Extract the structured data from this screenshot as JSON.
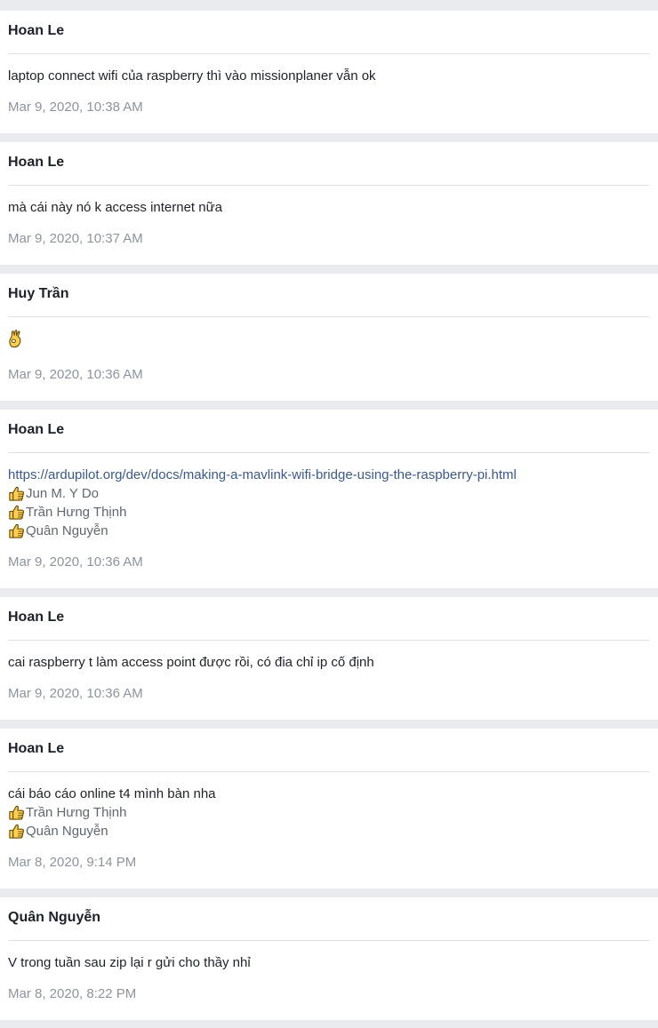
{
  "posts": [
    {
      "author": "Hoan Le",
      "lines": [
        {
          "type": "text",
          "text": "laptop connect wifi của raspberry thì vào missionplaner vẫn ok"
        }
      ],
      "reactions": [],
      "timestamp": "Mar 9, 2020, 10:38 AM"
    },
    {
      "author": "Hoan Le",
      "lines": [
        {
          "type": "text",
          "text": "mà cái này nó k access internet nữa"
        }
      ],
      "reactions": [],
      "timestamp": "Mar 9, 2020, 10:37 AM"
    },
    {
      "author": "Huy Trần",
      "lines": [
        {
          "type": "emoji",
          "icon": "ok-hand-icon"
        }
      ],
      "reactions": [],
      "timestamp": "Mar 9, 2020, 10:36 AM"
    },
    {
      "author": "Hoan Le",
      "lines": [
        {
          "type": "link",
          "text": "https://ardupilot.org/dev/docs/making-a-mavlink-wifi-bridge-using-the-raspberry-pi.html"
        }
      ],
      "reactions": [
        "Jun M. Y Do",
        "Trần Hưng Thịnh",
        "Quân Nguyễn"
      ],
      "timestamp": "Mar 9, 2020, 10:36 AM"
    },
    {
      "author": "Hoan Le",
      "lines": [
        {
          "type": "text",
          "text": "cai raspberry t làm access point được rồi, có đia chỉ ip cố định"
        }
      ],
      "reactions": [],
      "timestamp": "Mar 9, 2020, 10:36 AM"
    },
    {
      "author": "Hoan Le",
      "lines": [
        {
          "type": "text",
          "text": "cái báo cáo online t4 mình bàn nha"
        }
      ],
      "reactions": [
        "Trần Hưng Thịnh",
        "Quân Nguyễn"
      ],
      "timestamp": "Mar 8, 2020, 9:14 PM"
    },
    {
      "author": "Quân Nguyễn",
      "lines": [
        {
          "type": "text",
          "text": "V trong tuần sau zip lại r gửi cho thầy nhỉ"
        }
      ],
      "reactions": [],
      "timestamp": "Mar 8, 2020, 8:22 PM"
    }
  ],
  "icons": {
    "reaction": "thumbs-up-icon",
    "emoji": "ok-hand-icon"
  },
  "colors": {
    "background": "#e9ebee",
    "card": "#ffffff",
    "text": "#1d2129",
    "link": "#385898",
    "muted": "#606770",
    "timestamp": "#8d949e",
    "divider": "#dddfe2",
    "emoji_fill": "#fdd04f",
    "emoji_outline": "#6b4a00"
  }
}
